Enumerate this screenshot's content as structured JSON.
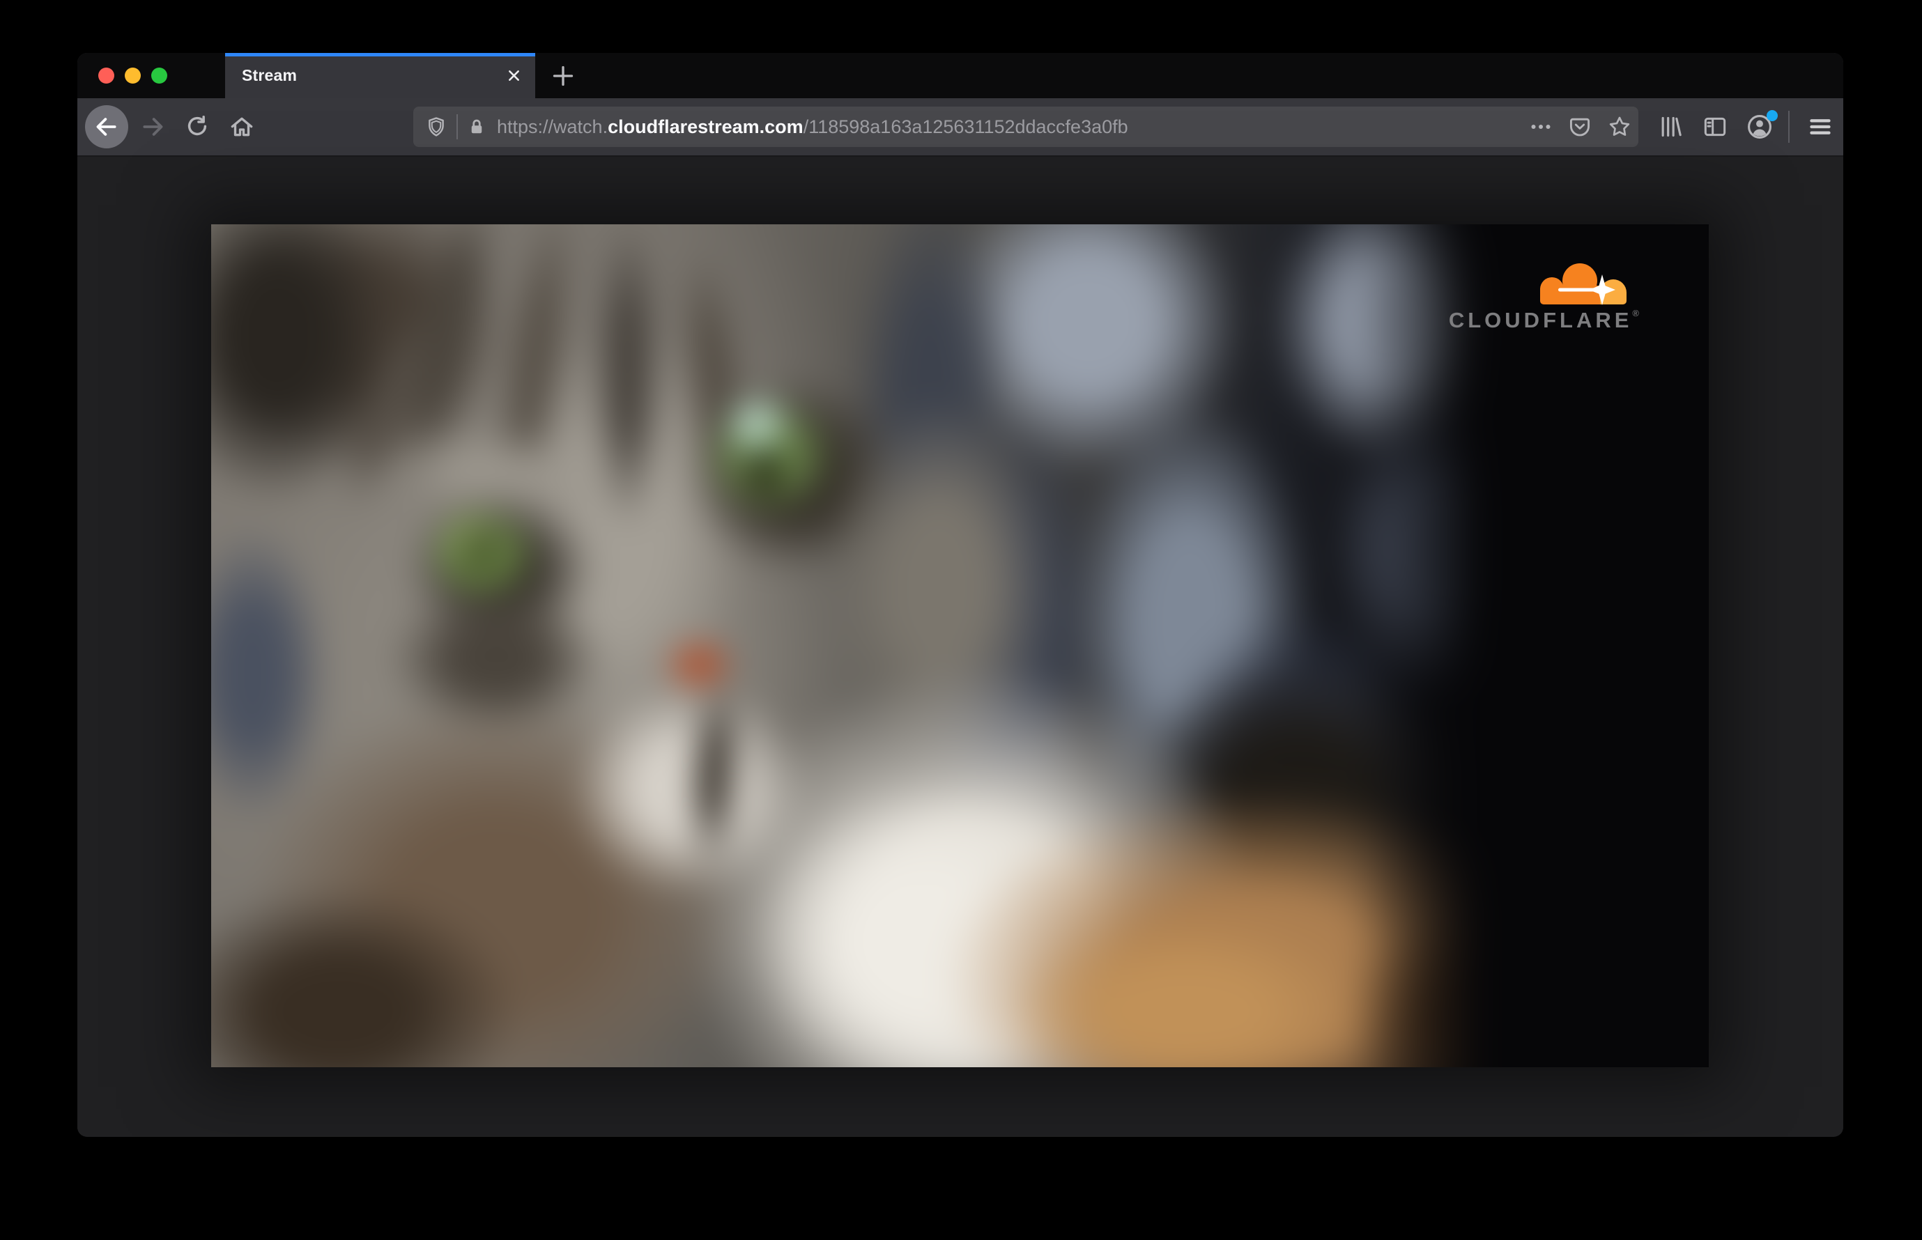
{
  "window_controls": {
    "close": "red",
    "minimize": "yellow",
    "zoom": "green"
  },
  "tab_bar": {
    "active_tab": {
      "title": "Stream"
    }
  },
  "toolbar": {
    "url_bar": {
      "url_scheme": "https://watch.",
      "url_domain": "cloudflarestream.com",
      "url_path": "/118598a163a125631152ddaccfe3a0fb"
    }
  },
  "page": {
    "video_player": {
      "brand_wordmark": "CLOUDFLARE",
      "brand_trademark": "®"
    }
  },
  "colors": {
    "active_tab_accent": "#2f87f8",
    "toolbar_bg": "#37373c",
    "tabbar_bg": "#0b0b0c",
    "urlbar_bg": "#48484c",
    "page_bg": "#202022",
    "notification_dot": "#18a9f2",
    "brand_orange": "#f6821f",
    "brand_orange_light": "#fbad41",
    "traffic_red": "#ff5f57",
    "traffic_yellow": "#febc2e",
    "traffic_green": "#28c840"
  },
  "icons": [
    "close-window",
    "minimize-window",
    "zoom-window",
    "close-tab-icon",
    "new-tab-icon",
    "back-icon",
    "forward-icon",
    "reload-icon",
    "home-icon",
    "shield-icon",
    "lock-icon",
    "page-actions-icon",
    "pocket-icon",
    "bookmark-star-icon",
    "library-icon",
    "sidebar-icon",
    "account-icon",
    "menu-icon",
    "cloudflare-cloud-icon"
  ]
}
